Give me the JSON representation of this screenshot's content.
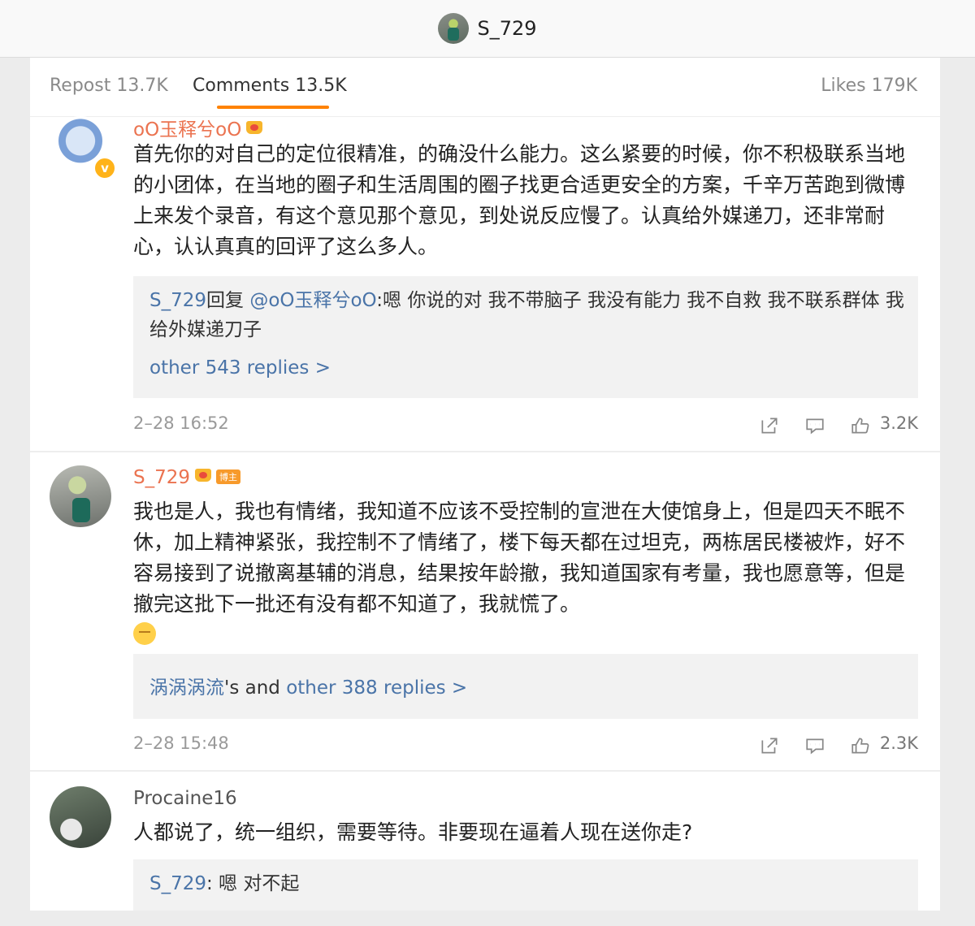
{
  "header": {
    "title": "S_729",
    "avatar": "profile-avatar"
  },
  "tabs": [
    {
      "label": "Repost 13.7K"
    },
    {
      "label": "Comments 13.5K"
    },
    {
      "label": "Likes 179K"
    }
  ],
  "accent_color": "#ff8200",
  "comments": [
    {
      "user": "oO玉释兮oO",
      "verified_badge": "v",
      "text": "首先你的对自己的定位很精准，的确没什么能力。这么紧要的时候，你不积极联系当地的小团体，在当地的圈子和生活周围的圈子找更合适更安全的方案，千辛万苦跑到微博上来发个录音，有这个意见那个意见，到处说反应慢了。认真给外媒递刀，还非常耐心，认认真真的回评了这么多人。",
      "reply": {
        "author": "S_729",
        "verb": "回复",
        "mention": "@oO玉释兮oO",
        "text": ":嗯 你说的对 我不带脑子 我没有能力 我不自救 我不联系群体 我给外媒递刀子"
      },
      "more_replies": "other 543 replies >",
      "time": "2–28 16:52",
      "likes": "3.2K"
    },
    {
      "user": "S_729",
      "host_badge": "博主",
      "text": "我也是人，我也有情绪，我知道不应该不受控制的宣泄在大使馆身上，但是四天不眠不休，加上精神紧张，我控制不了情绪了，楼下每天都在过坦克，两栋居民楼被炸，好不容易接到了说撤离基辅的消息，结果按年龄撤，我知道国家有考量，我也愿意等，但是撤完这批下一批还有没有都不知道了，我就慌了。",
      "more_replies": {
        "name": "涡涡涡流",
        "middle": "'s and ",
        "link": "other 388 replies >"
      },
      "time": "2–28 15:48",
      "likes": "2.3K"
    },
    {
      "user": "Procaine16",
      "text": "人都说了，统一组织，需要等待。非要现在逼着人现在送你走?",
      "reply": {
        "author": "S_729",
        "text": ": 嗯 对不起"
      }
    }
  ]
}
